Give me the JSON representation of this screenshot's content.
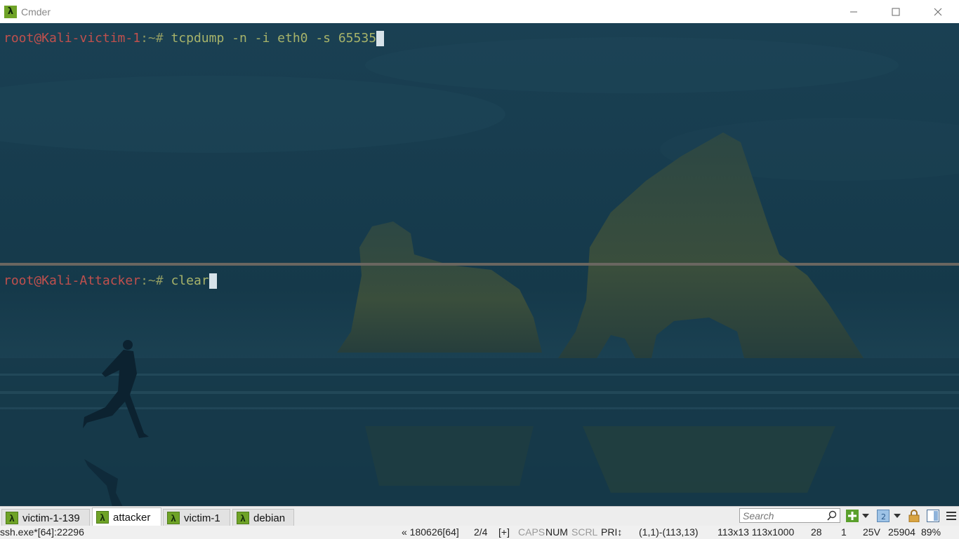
{
  "window": {
    "title": "Cmder",
    "logo_glyph": "λ"
  },
  "panes": [
    {
      "user_host": "root@Kali-victim-1",
      "path": ":~# ",
      "command": "tcpdump -n -i eth0 -s 65535"
    },
    {
      "user_host": "root@Kali-Attacker",
      "path": ":~# ",
      "command": "clear"
    }
  ],
  "tabs": [
    {
      "label": "victim-1-139",
      "active": false
    },
    {
      "label": "attacker",
      "active": true
    },
    {
      "label": "victim-1",
      "active": false
    },
    {
      "label": "debian",
      "active": false
    }
  ],
  "tab_icon_glyph": "λ",
  "search": {
    "placeholder": "Search"
  },
  "statusbar": {
    "process": "ssh.exe*[64]:22296",
    "buffer": "« 180626[64]",
    "console_index": "2/4",
    "plus": "[+]",
    "caps": "CAPS",
    "num": "NUM",
    "scrl": "SCRL",
    "pri": "PRI↕",
    "selection": "(1,1)-(113,13)",
    "size": "113x13 113x1000",
    "val1": "28",
    "val2": "1",
    "val3": "25V",
    "val4": "25904",
    "zoom": "89%"
  },
  "colors": {
    "prompt_user": "#c0504d",
    "prompt_path": "#8f9a62",
    "command": "#a7b36a",
    "accent_green": "#6fa327"
  }
}
